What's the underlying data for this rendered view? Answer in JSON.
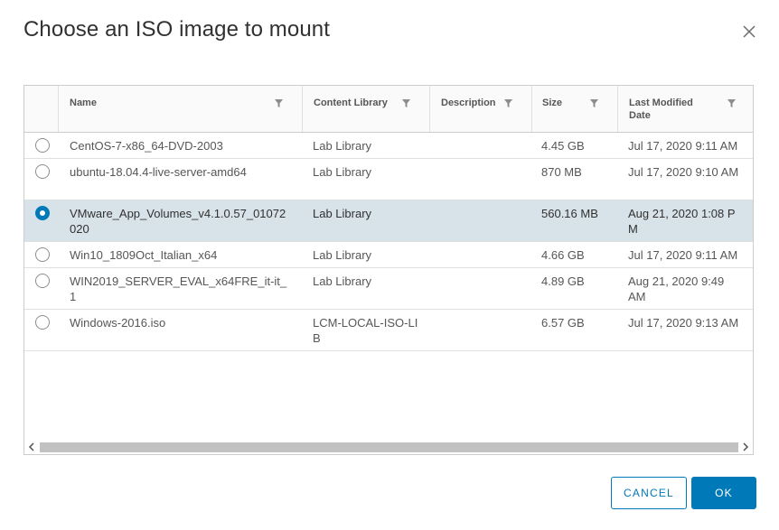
{
  "dialog": {
    "title": "Choose an ISO image to mount",
    "close_icon": "close-icon"
  },
  "grid": {
    "columns": [
      {
        "key": "name",
        "label": "Name"
      },
      {
        "key": "library",
        "label": "Content Library"
      },
      {
        "key": "description",
        "label": "Description"
      },
      {
        "key": "size",
        "label": "Size"
      },
      {
        "key": "modified",
        "label": "Last Modified Date"
      }
    ],
    "filter_icon": "filter-icon",
    "rows": [
      {
        "name": "CentOS-7-x86_64-DVD-2003",
        "library": "Lab Library",
        "description": "",
        "size": "4.45 GB",
        "modified": "Jul 17, 2020 9:11 AM",
        "selected": false
      },
      {
        "name": "ubuntu-18.04.4-live-server-amd64",
        "library": "Lab Library",
        "description": "",
        "size": "870 MB",
        "modified": "Jul 17, 2020 9:10 AM",
        "selected": false
      },
      {
        "name": "VMware_App_Volumes_v4.1.0.57_01072020",
        "library": "Lab Library",
        "description": "",
        "size": "560.16 MB",
        "modified": "Aug 21, 2020 1:08 PM",
        "selected": true
      },
      {
        "name": "Win10_1809Oct_Italian_x64",
        "library": "Lab Library",
        "description": "",
        "size": "4.66 GB",
        "modified": "Jul 17, 2020 9:11 AM",
        "selected": false
      },
      {
        "name": "WIN2019_SERVER_EVAL_x64FRE_it-it_1",
        "library": "Lab Library",
        "description": "",
        "size": "4.89 GB",
        "modified": "Aug 21, 2020 9:49 AM",
        "selected": false
      },
      {
        "name": "Windows-2016.iso",
        "library": "LCM-LOCAL-ISO-LIB",
        "description": "",
        "size": "6.57 GB",
        "modified": "Jul 17, 2020 9:13 AM",
        "selected": false
      }
    ]
  },
  "buttons": {
    "cancel": "CANCEL",
    "ok": "OK"
  },
  "colors": {
    "accent": "#0079b8",
    "selected_row": "#d8e3e9"
  }
}
